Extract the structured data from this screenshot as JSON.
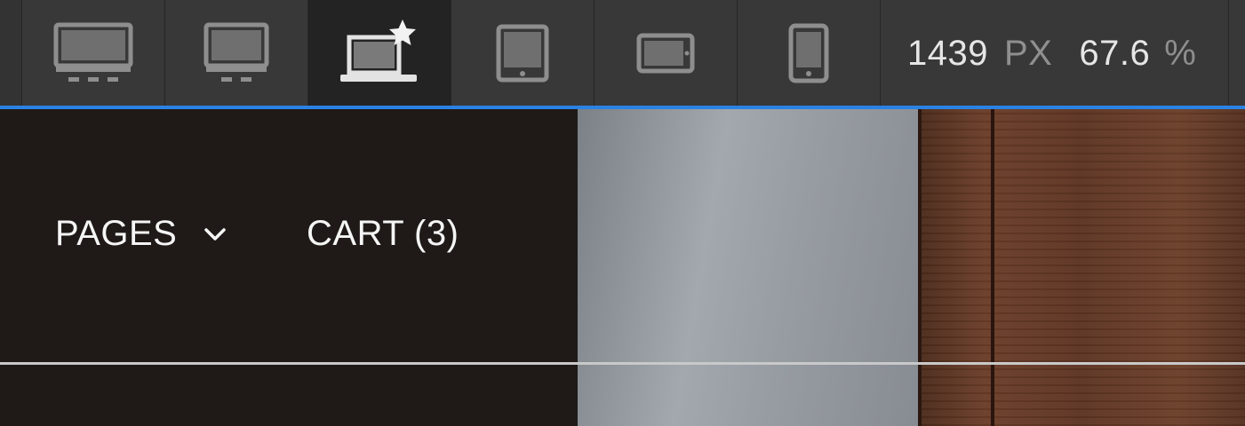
{
  "toolbar": {
    "devices": [
      {
        "name": "desktop-large",
        "icon": "monitor-large-icon",
        "active": false
      },
      {
        "name": "desktop",
        "icon": "monitor-icon",
        "active": false
      },
      {
        "name": "laptop-default",
        "icon": "laptop-star-icon",
        "active": true
      },
      {
        "name": "tablet-portrait",
        "icon": "tablet-portrait-icon",
        "active": false
      },
      {
        "name": "tablet-landscape",
        "icon": "tablet-landscape-icon",
        "active": false
      },
      {
        "name": "phone",
        "icon": "phone-icon",
        "active": false
      }
    ],
    "width_value": "1439",
    "width_unit": "PX",
    "zoom_value": "67.6",
    "zoom_unit": "%"
  },
  "colors": {
    "accent": "#2a82e4",
    "toolbar_bg": "#383838",
    "nav_bg": "#1f1a18",
    "nav_text": "#f5f5f5"
  },
  "preview": {
    "nav": {
      "pages_label": "PAGES",
      "cart_label": "CART (3)"
    }
  }
}
